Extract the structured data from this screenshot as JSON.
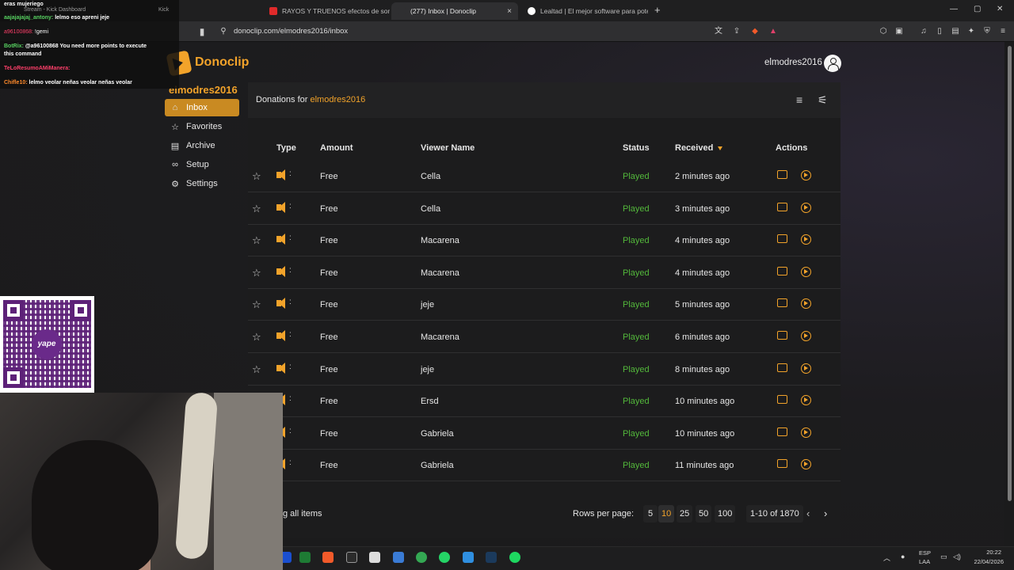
{
  "browser": {
    "tabs": [
      {
        "title": "RAYOS Y TRUENOS efectos de sonid",
        "active": false
      },
      {
        "title": "(277) Inbox | Donoclip",
        "active": true
      },
      {
        "title": "Lealtad | El mejor software para pote",
        "active": false
      }
    ],
    "url": "donoclip.com/elmodres2016/inbox",
    "new_tab": "+",
    "close": "×"
  },
  "app": {
    "logo_text": "Donoclip",
    "username": "elmodres2016",
    "brand_color": "#f2a32a"
  },
  "sidebar": {
    "user": "elmodres2016",
    "items": [
      {
        "label": "Inbox",
        "icon": "inbox-icon",
        "active": true
      },
      {
        "label": "Favorites",
        "icon": "star-icon",
        "active": false
      },
      {
        "label": "Archive",
        "icon": "archive-icon",
        "active": false
      },
      {
        "label": "Setup",
        "icon": "link-icon",
        "active": false
      },
      {
        "label": "Settings",
        "icon": "gear-icon",
        "active": false
      }
    ]
  },
  "panel": {
    "title_prefix": "Donations for",
    "title_user": "elmodres2016"
  },
  "table": {
    "headers": {
      "type": "Type",
      "amount": "Amount",
      "viewer": "Viewer Name",
      "status": "Status",
      "received": "Received",
      "actions": "Actions"
    },
    "rows": [
      {
        "amount": "Free",
        "viewer": "Cella",
        "status": "Played",
        "received": "2 minutes ago"
      },
      {
        "amount": "Free",
        "viewer": "Cella",
        "status": "Played",
        "received": "3 minutes ago"
      },
      {
        "amount": "Free",
        "viewer": "Macarena",
        "status": "Played",
        "received": "4 minutes ago"
      },
      {
        "amount": "Free",
        "viewer": "Macarena",
        "status": "Played",
        "received": "4 minutes ago"
      },
      {
        "amount": "Free",
        "viewer": "jeje",
        "status": "Played",
        "received": "5 minutes ago"
      },
      {
        "amount": "Free",
        "viewer": "Macarena",
        "status": "Played",
        "received": "6 minutes ago"
      },
      {
        "amount": "Free",
        "viewer": "jeje",
        "status": "Played",
        "received": "8 minutes ago"
      },
      {
        "amount": "Free",
        "viewer": "Ersd",
        "status": "Played",
        "received": "10 minutes ago"
      },
      {
        "amount": "Free",
        "viewer": "Gabriela",
        "status": "Played",
        "received": "10 minutes ago"
      },
      {
        "amount": "Free",
        "viewer": "Gabriela",
        "status": "Played",
        "received": "11 minutes ago"
      }
    ]
  },
  "footer": {
    "select_all": "g all items",
    "rows_per_page_label": "Rows per page:",
    "page_sizes": [
      "5",
      "10",
      "25",
      "50",
      "100"
    ],
    "selected_size": "10",
    "range": "1-10 of 1870"
  },
  "taskbar": {
    "lang_top": "ESP",
    "lang_bottom": "LAA",
    "time": "20:22",
    "date": "22/04/2026"
  },
  "overlay": {
    "chat": [
      {
        "name": "",
        "text": "eras mujeriego"
      },
      {
        "name": "aajajajajaj_antony:",
        "text": " lelmo eso apreni jeje"
      },
      {
        "name": "a96100868:",
        "text": " !gemi"
      },
      {
        "name": "BotRix:",
        "text": " @a96100868 You need more points to execute"
      },
      {
        "name": "",
        "text": "this command"
      },
      {
        "name": "TeLoResumoAMiManera:",
        "text": ""
      },
      {
        "name": "Chifle10:",
        "text": " lelmo veolar neñas veolar neñas veolar"
      }
    ],
    "stream_tab": "Stream - Kick Dashboard",
    "kick_tab": "Kick",
    "qr_logo": "yape"
  }
}
